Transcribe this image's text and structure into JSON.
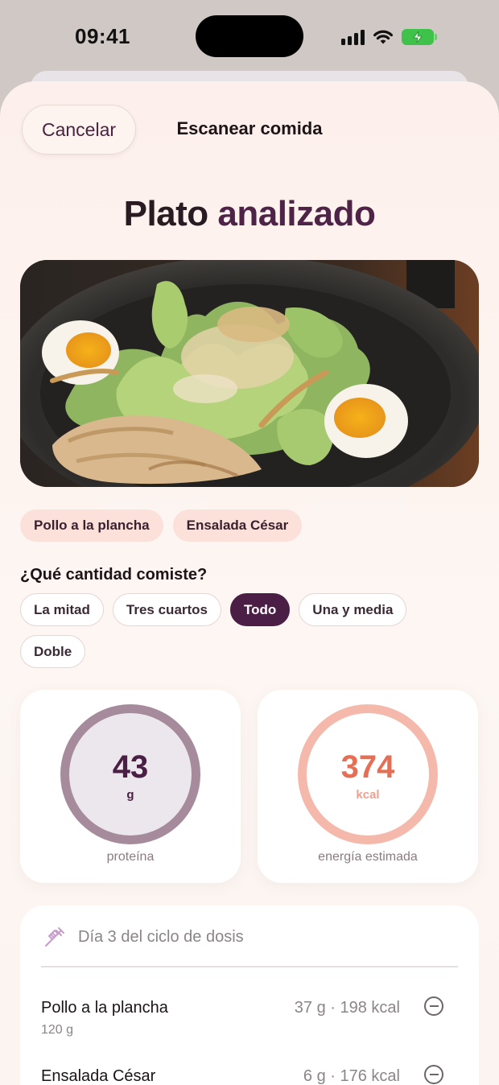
{
  "status_bar": {
    "time": "09:41"
  },
  "header": {
    "cancel_label": "Cancelar",
    "title": "Escanear comida"
  },
  "page_title": {
    "main": "Plato ",
    "accent": "analizado"
  },
  "photo": {
    "subject": "Ensalada César con pollo a la plancha y huevos"
  },
  "detected_foods": [
    "Pollo a la plancha",
    "Ensalada César"
  ],
  "portion": {
    "question": "¿Qué cantidad comiste?",
    "options": [
      "La mitad",
      "Tres cuartos",
      "Todo",
      "Una y media",
      "Doble"
    ],
    "selected": "Todo"
  },
  "stats": {
    "protein": {
      "value": "43",
      "unit": "g",
      "label": "proteína",
      "color": "#4b1f45"
    },
    "energy": {
      "value": "374",
      "unit": "kcal",
      "label": "energía estimada",
      "color": "#e8735a"
    }
  },
  "dose": {
    "text": "Día 3 del ciclo de dosis",
    "icon": "syringe-icon"
  },
  "items": [
    {
      "name": "Pollo a la plancha",
      "weight": "120 g",
      "macro": "37 g · 198 kcal"
    },
    {
      "name": "Ensalada César",
      "weight": "",
      "macro": "6 g · 176 kcal"
    }
  ]
}
